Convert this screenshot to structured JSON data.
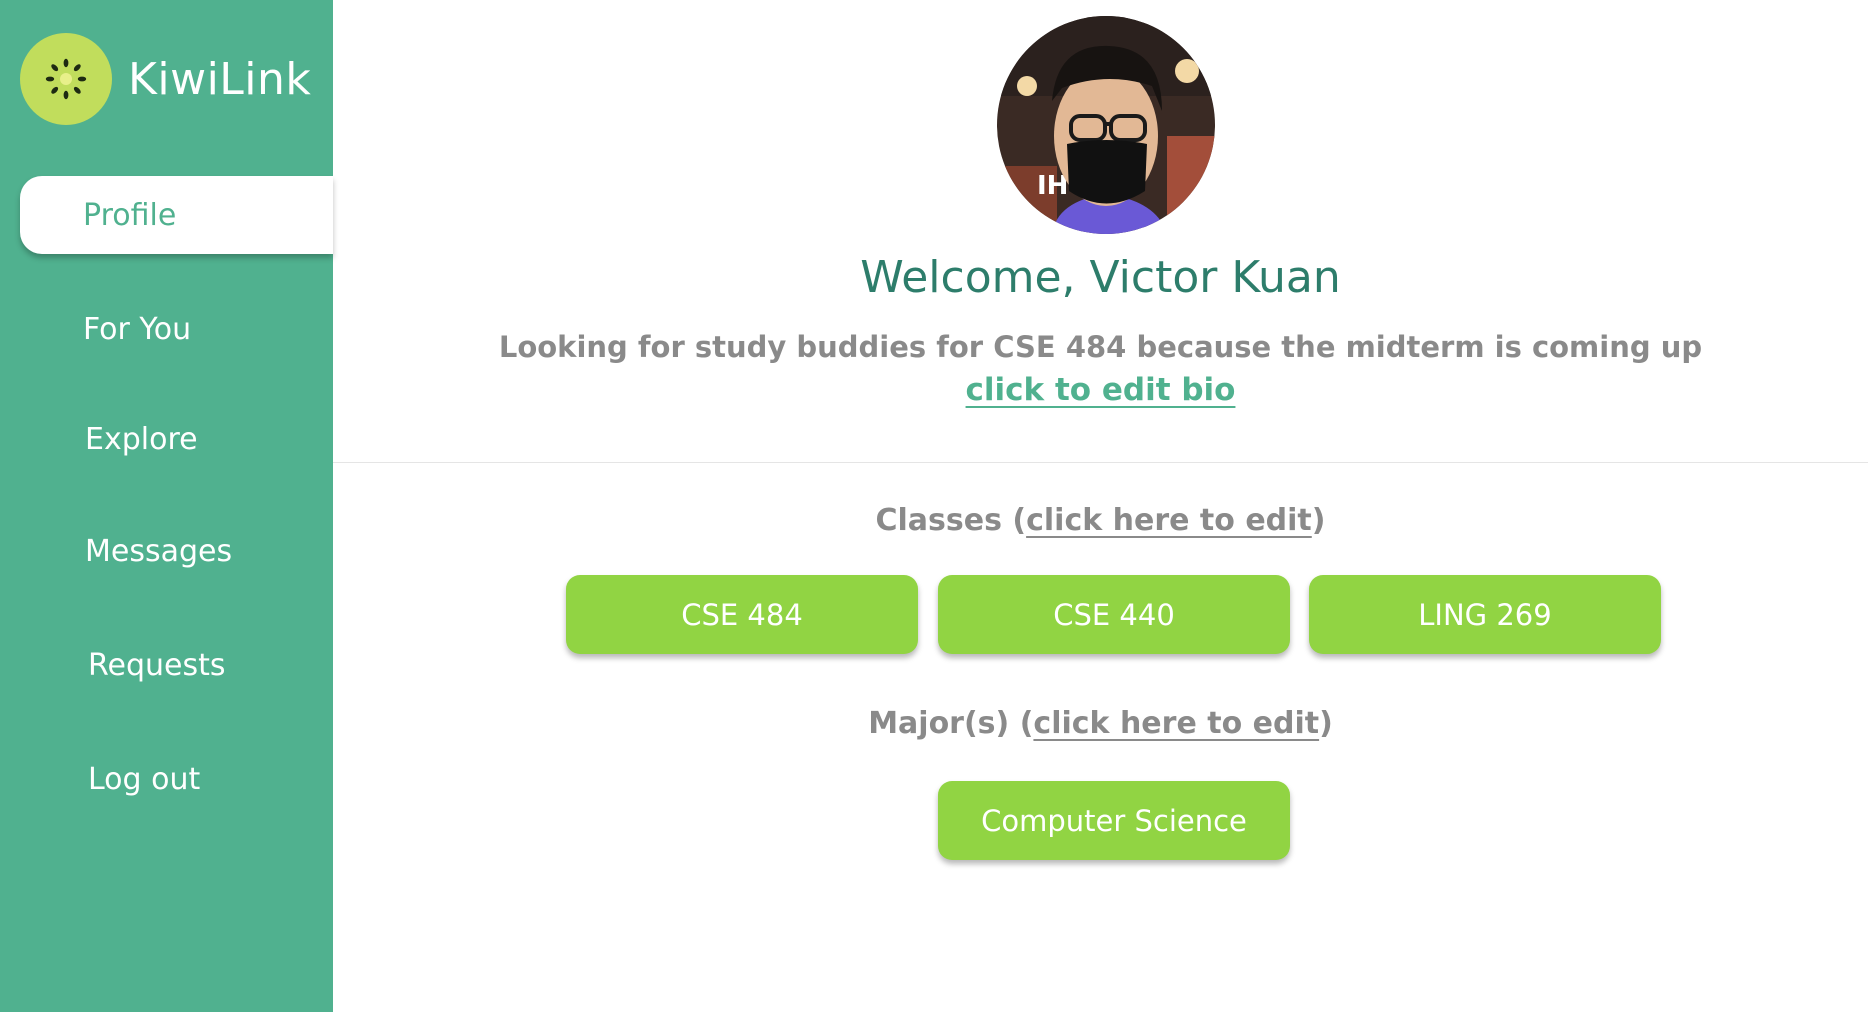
{
  "brand": {
    "name": "KiwiLink"
  },
  "sidebar": {
    "items": [
      {
        "label": "Profile",
        "active": true
      },
      {
        "label": "For You"
      },
      {
        "label": "Explore"
      },
      {
        "label": "Messages"
      },
      {
        "label": "Requests"
      },
      {
        "label": "Log out"
      }
    ]
  },
  "profile": {
    "welcome": "Welcome, Victor Kuan",
    "bio": "Looking for study buddies for CSE 484 because the midterm is coming up",
    "edit_bio_label": "click to edit bio"
  },
  "classes": {
    "title_prefix": "Classes (",
    "edit_label": "click here to edit",
    "title_suffix": ")",
    "items": [
      "CSE 484",
      "CSE 440",
      "LING 269"
    ]
  },
  "majors": {
    "title_prefix": "Major(s) (",
    "edit_label": "click here to edit",
    "title_suffix": ")",
    "items": [
      "Computer Science"
    ]
  },
  "colors": {
    "sidebar": "#50b18f",
    "accent": "#50b18f",
    "chip": "#91d443",
    "logo": "#c1dd5c",
    "welcome": "#2d7d6b",
    "muted_text": "#8a8a8a"
  },
  "icons": {
    "logo": "kiwi-icon",
    "avatar": "profile-photo"
  }
}
